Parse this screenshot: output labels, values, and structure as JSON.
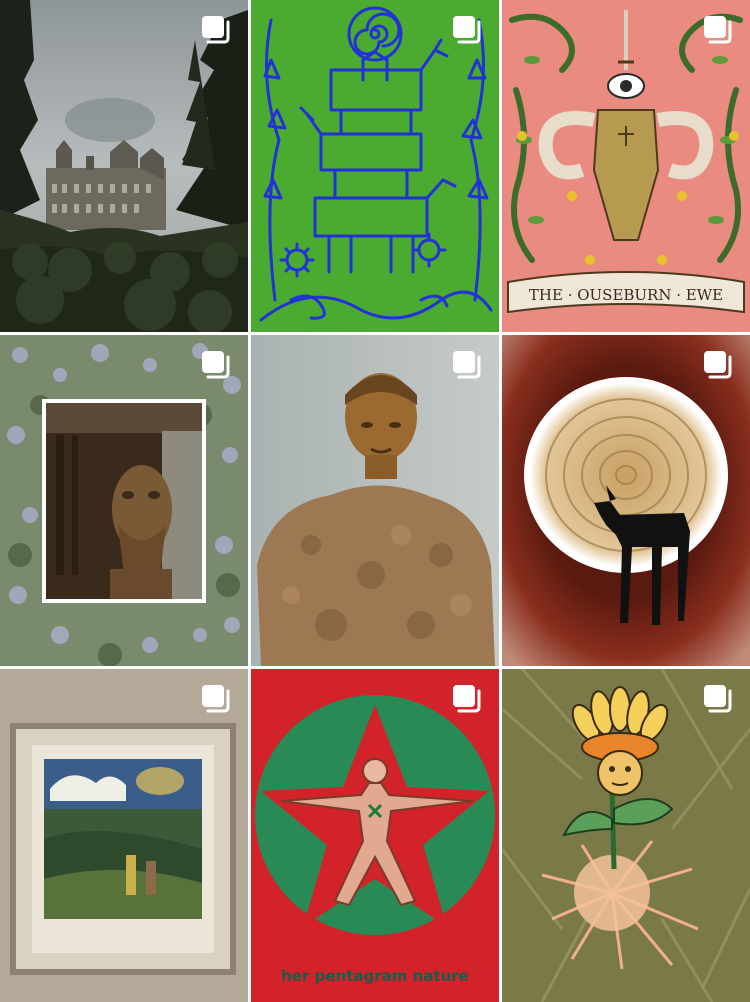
{
  "grid": {
    "columns": 3,
    "rows": 3,
    "posts": [
      {
        "id": "post-1",
        "subject": "gothic mansion on wooded hill under grey sky",
        "multi": true,
        "icon": "multiple-posts-icon"
      },
      {
        "id": "post-2",
        "subject": "blue line drawing of stacked deer and sun on green",
        "multi": true,
        "icon": "multiple-posts-icon"
      },
      {
        "id": "post-3",
        "subject": "ram skull illustration with vines on pink",
        "multi": true,
        "icon": "multiple-posts-icon",
        "banner_text": "THE · OUSEBURN · EWE"
      },
      {
        "id": "post-4",
        "subject": "carved wooden bearded face over lavender bush",
        "multi": true,
        "icon": "multiple-posts-icon"
      },
      {
        "id": "post-5",
        "subject": "terracotta head bust on rough stone base",
        "multi": true,
        "icon": "multiple-posts-icon"
      },
      {
        "id": "post-6",
        "subject": "black horse silhouette before spiral sun",
        "multi": true,
        "icon": "multiple-posts-icon"
      },
      {
        "id": "post-7",
        "subject": "framed small painting of figures in landscape",
        "multi": true,
        "icon": "multiple-posts-icon"
      },
      {
        "id": "post-8",
        "subject": "figure in red star on green circle",
        "multi": true,
        "icon": "multiple-posts-icon",
        "caption": "her pentagram nature"
      },
      {
        "id": "post-9",
        "subject": "dandelion flower character drawn over photo",
        "multi": true,
        "icon": "multiple-posts-icon"
      }
    ]
  },
  "colors": {
    "gutter": "#ffffff",
    "icon": "#ffffff"
  }
}
